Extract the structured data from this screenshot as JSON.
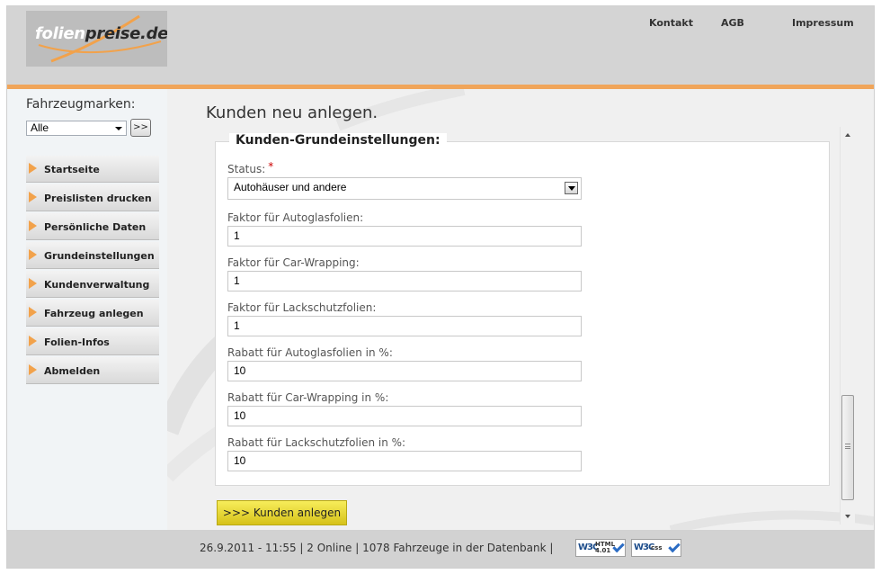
{
  "header": {
    "logo": {
      "part1": "folien",
      "part2": "preise.de"
    },
    "links": [
      "Kontakt",
      "AGB",
      "Impressum"
    ]
  },
  "sidebar": {
    "brand_label": "Fahrzeugmarken:",
    "brand_select_value": "Alle",
    "brand_go_label": ">>",
    "nav": [
      {
        "label": "Startseite"
      },
      {
        "label": "Preislisten drucken"
      },
      {
        "label": "Persönliche Daten"
      },
      {
        "label": "Grundeinstellungen"
      },
      {
        "label": "Kundenverwaltung"
      },
      {
        "label": "Fahrzeug anlegen"
      },
      {
        "label": "Folien-Infos"
      },
      {
        "label": "Abmelden"
      }
    ]
  },
  "main": {
    "page_title": "Kunden neu anlegen.",
    "fieldset_legend": "Kunden-Grundeinstellungen:",
    "status": {
      "label": "Status:",
      "required_mark": "*",
      "value": "Autohäuser und andere"
    },
    "fields": [
      {
        "label": "Faktor für Autoglasfolien:",
        "value": "1"
      },
      {
        "label": "Faktor für Car-Wrapping:",
        "value": "1"
      },
      {
        "label": "Faktor für Lackschutzfolien:",
        "value": "1"
      },
      {
        "label": "Rabatt für Autoglasfolien in %:",
        "value": "10"
      },
      {
        "label": "Rabatt für Car-Wrapping in %:",
        "value": "10"
      },
      {
        "label": "Rabatt für Lackschutzfolien in %:",
        "value": "10"
      }
    ],
    "submit_label": ">>> Kunden anlegen"
  },
  "footer": {
    "text": "26.9.2011 - 11:55 | 2 Online | 1078 Fahrzeuge in der Datenbank |",
    "badges": [
      {
        "w3": "W3C",
        "kind_line1": "HTML",
        "kind_line2": "4.01"
      },
      {
        "w3": "W3C",
        "kind_line1": "css",
        "kind_line2": ""
      }
    ]
  },
  "colors": {
    "accent_orange": "#f0a55a",
    "nav_chevron": "#f2a24b",
    "submit_yellow": "#e6d52e",
    "required_red": "#cc0000"
  },
  "icons": [
    "chevron-right-icon",
    "dropdown-arrow-icon",
    "w3c-check-icon"
  ]
}
